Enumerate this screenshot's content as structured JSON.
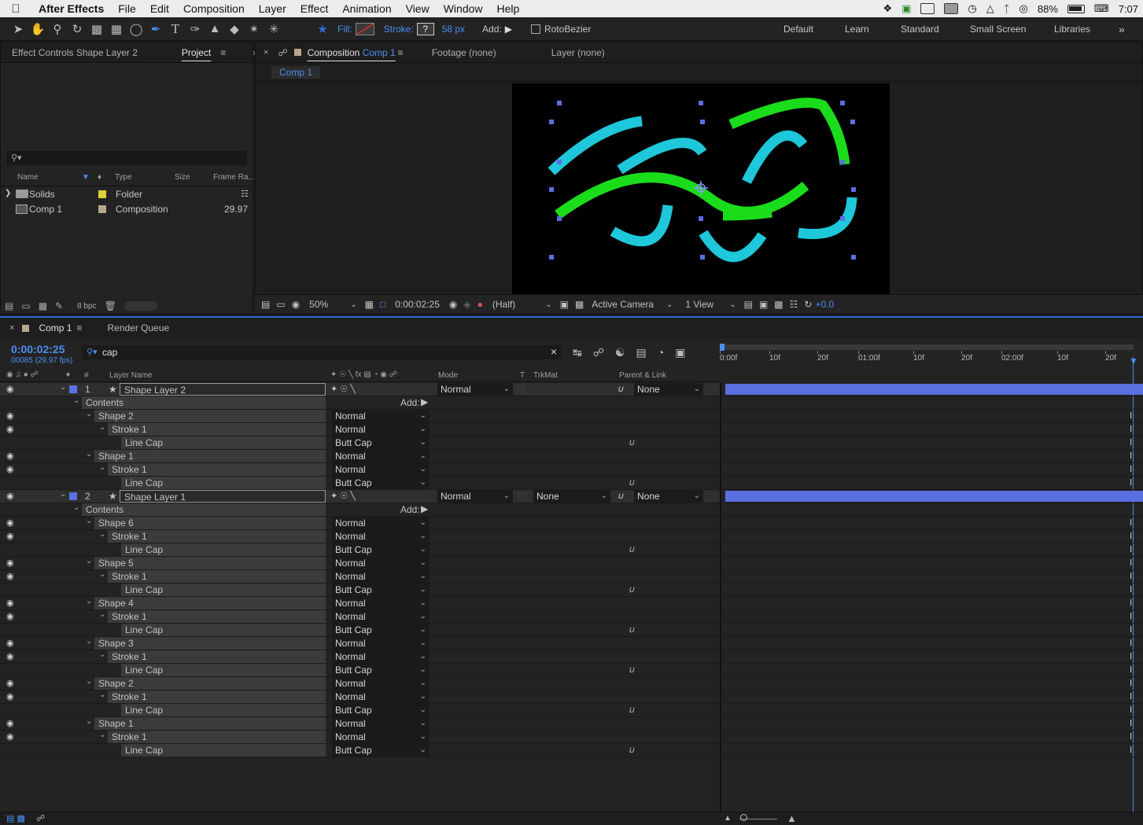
{
  "menubar": {
    "apple": "",
    "items": [
      "After Effects",
      "File",
      "Edit",
      "Composition",
      "Layer",
      "Effect",
      "Animation",
      "View",
      "Window",
      "Help"
    ],
    "battery": "88%",
    "time": "7:07"
  },
  "toolbar": {
    "fill_label": "Fill:",
    "stroke_label": "Stroke:",
    "stroke_swatch": "?",
    "stroke_width": "58 px",
    "add_label": "Add:",
    "rotobezier": "RotoBezier",
    "workspaces": [
      "Default",
      "Learn",
      "Standard",
      "Small Screen",
      "Libraries"
    ]
  },
  "project": {
    "tab_effect": "Effect Controls Shape Layer 2",
    "tab_project": "Project",
    "columns": {
      "name": "Name",
      "type": "Type",
      "size": "Size",
      "frame": "Frame Ra..."
    },
    "items": [
      {
        "name": "Solids",
        "type": "Folder",
        "frame": "",
        "color": "#e0cf3c"
      },
      {
        "name": "Comp 1",
        "type": "Composition",
        "frame": "29.97",
        "color": "#b7a88a"
      }
    ],
    "bpc": "8 bpc"
  },
  "composition": {
    "tab_comp_prefix": "Composition",
    "tab_comp_name": "Comp 1",
    "tab_footage": "Footage (none)",
    "tab_layer": "Layer (none)",
    "breadcrumb": "Comp 1",
    "zoom": "50%",
    "timecode": "0:00:02:25",
    "resolution": "(Half)",
    "camera": "Active Camera",
    "views": "1 View",
    "exposure": "+0.0",
    "colors": {
      "cyan": "#1ec7d9",
      "green": "#1bdc1b",
      "handle": "#5b6fe0"
    }
  },
  "timeline": {
    "tab_comp": "Comp 1",
    "tab_render": "Render Queue",
    "timecode": "0:00:02:25",
    "fps": "00085 (29.97 fps)",
    "search": "cap",
    "headers": {
      "num": "#",
      "layer_name": "Layer Name",
      "mode": "Mode",
      "t": "T",
      "trkmat": "TrkMat",
      "parent": "Parent & Link"
    },
    "ruler": [
      "0:00f",
      "10f",
      "20f",
      "01:00f",
      "10f",
      "20f",
      "02:00f",
      "10f",
      "20f"
    ],
    "rows": [
      {
        "kind": "layer",
        "num": "1",
        "label": "Shape Layer 2",
        "mode": "Normal",
        "trkmat": "",
        "parent": "None"
      },
      {
        "kind": "contents",
        "label": "Contents",
        "add": "Add:"
      },
      {
        "kind": "shape",
        "label": "Shape 2",
        "value": "Normal"
      },
      {
        "kind": "stroke",
        "label": "Stroke 1",
        "value": "Normal"
      },
      {
        "kind": "cap",
        "label": "Line Cap",
        "value": "Butt Cap"
      },
      {
        "kind": "shape",
        "label": "Shape 1",
        "value": "Normal"
      },
      {
        "kind": "stroke",
        "label": "Stroke 1",
        "value": "Normal"
      },
      {
        "kind": "cap",
        "label": "Line Cap",
        "value": "Butt Cap"
      },
      {
        "kind": "layer",
        "num": "2",
        "label": "Shape Layer 1",
        "mode": "Normal",
        "trkmat": "None",
        "parent": "None"
      },
      {
        "kind": "contents",
        "label": "Contents",
        "add": "Add:"
      },
      {
        "kind": "shape",
        "label": "Shape 6",
        "value": "Normal"
      },
      {
        "kind": "stroke",
        "label": "Stroke 1",
        "value": "Normal"
      },
      {
        "kind": "cap",
        "label": "Line Cap",
        "value": "Butt Cap"
      },
      {
        "kind": "shape",
        "label": "Shape 5",
        "value": "Normal"
      },
      {
        "kind": "stroke",
        "label": "Stroke 1",
        "value": "Normal"
      },
      {
        "kind": "cap",
        "label": "Line Cap",
        "value": "Butt Cap"
      },
      {
        "kind": "shape",
        "label": "Shape 4",
        "value": "Normal"
      },
      {
        "kind": "stroke",
        "label": "Stroke 1",
        "value": "Normal"
      },
      {
        "kind": "cap",
        "label": "Line Cap",
        "value": "Butt Cap"
      },
      {
        "kind": "shape",
        "label": "Shape 3",
        "value": "Normal"
      },
      {
        "kind": "stroke",
        "label": "Stroke 1",
        "value": "Normal"
      },
      {
        "kind": "cap",
        "label": "Line Cap",
        "value": "Butt Cap"
      },
      {
        "kind": "shape",
        "label": "Shape 2",
        "value": "Normal"
      },
      {
        "kind": "stroke",
        "label": "Stroke 1",
        "value": "Normal"
      },
      {
        "kind": "cap",
        "label": "Line Cap",
        "value": "Butt Cap"
      },
      {
        "kind": "shape",
        "label": "Shape 1",
        "value": "Normal"
      },
      {
        "kind": "stroke",
        "label": "Stroke 1",
        "value": "Normal"
      },
      {
        "kind": "cap",
        "label": "Line Cap",
        "value": "Butt Cap"
      }
    ]
  }
}
